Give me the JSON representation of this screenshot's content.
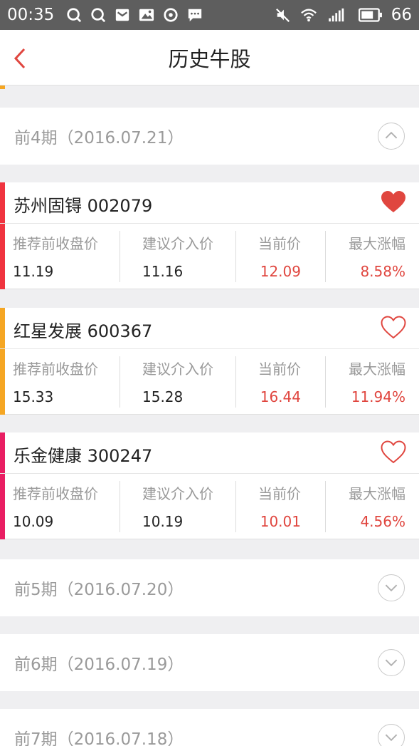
{
  "statusbar": {
    "time": "00:35",
    "battery": "66"
  },
  "navbar": {
    "title": "历史牛股"
  },
  "colors": {
    "accent_red": "#e0463f",
    "bar_red": "#f0343f",
    "bar_orange": "#f5a623",
    "bar_pink": "#e91e63"
  },
  "periods": [
    {
      "label": "前4期（2016.07.21）",
      "expanded": true
    },
    {
      "label": "前5期（2016.07.20）",
      "expanded": false
    },
    {
      "label": "前6期（2016.07.19）",
      "expanded": false
    },
    {
      "label": "前7期（2016.07.18）",
      "expanded": false
    }
  ],
  "column_labels": {
    "prev_close": "推荐前收盘价",
    "suggest": "建议介入价",
    "current": "当前价",
    "max_gain": "最大涨幅"
  },
  "stocks": [
    {
      "name": "苏州固锝 002079",
      "prev_close": "11.19",
      "suggest": "11.16",
      "current": "12.09",
      "max_gain": "8.58%",
      "favorited": true,
      "bar_color": "#f0343f"
    },
    {
      "name": "红星发展 600367",
      "prev_close": "15.33",
      "suggest": "15.28",
      "current": "16.44",
      "max_gain": "11.94%",
      "favorited": false,
      "bar_color": "#f5a623"
    },
    {
      "name": "乐金健康 300247",
      "prev_close": "10.09",
      "suggest": "10.19",
      "current": "10.01",
      "max_gain": "4.56%",
      "favorited": false,
      "bar_color": "#e91e63"
    }
  ]
}
